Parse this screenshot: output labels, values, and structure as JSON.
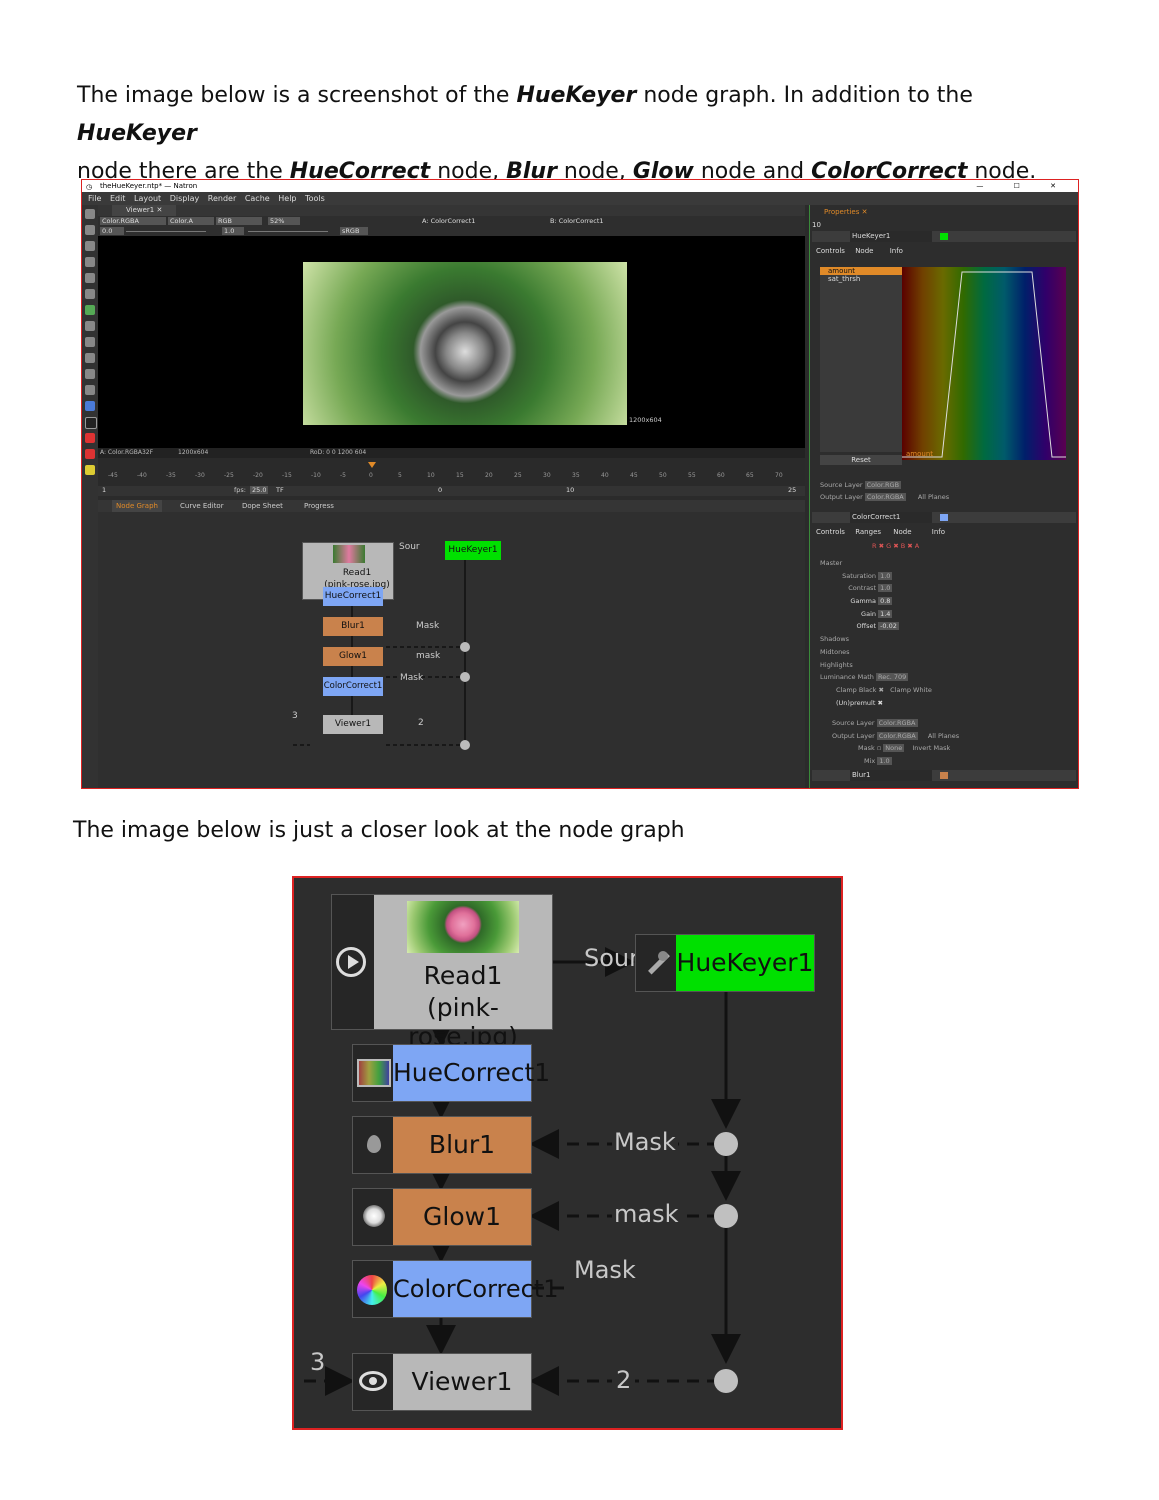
{
  "intro": {
    "line1_pre": "The image below is a screenshot of the ",
    "line1_b1": "HueKeyer",
    "line1_mid": " node graph. In addition to the ",
    "line1_b2": "HueKeyer",
    "line2_pre": "node there are the ",
    "line2_b1": "HueCorrect",
    "line2_s1": " node, ",
    "line2_b2": "Blur",
    "line2_s2": " node, ",
    "line2_b3": "Glow",
    "line2_s3": " node and ",
    "line2_b4": "ColorCorrect",
    "line2_s4": " node."
  },
  "screenshot": {
    "window_title": "theHueKeyer.ntp* — Natron",
    "window_controls": "—  ☐  ✕",
    "menu": [
      "File",
      "Edit",
      "Layout",
      "Display",
      "Render",
      "Cache",
      "Help",
      "Tools"
    ],
    "viewer_tab": "Viewer1  ✕",
    "layer": "Color.RGBA",
    "alpha": "Color.A",
    "channels": "RGB",
    "zoom": "52%",
    "exposure": "0.0",
    "gamma": "1.0",
    "colorspace": "sRGB",
    "input_a": "A: ColorCorrect1",
    "input_b": "B: ColorCorrect1",
    "image_size": "1200x604",
    "info_format": "A: Color.RGBA32F",
    "info_size": "1200x604",
    "info_rod": "RoD: 0 0 1200 604",
    "timeline_ticks": [
      "-45",
      "-40",
      "-35",
      "-30",
      "-25",
      "-20",
      "-15",
      "-10",
      "-5",
      "0",
      "5",
      "10",
      "15",
      "20",
      "25",
      "30",
      "35",
      "40",
      "45",
      "50",
      "55",
      "60",
      "65",
      "70"
    ],
    "frame_start": "1",
    "fps_label": "fps:",
    "fps": "25.0",
    "tf": "TF",
    "current_frame": "0",
    "increment": "10",
    "frame_end": "25",
    "panel_tabs": [
      "Node Graph",
      "Curve Editor",
      "Dope Sheet",
      "Progress"
    ],
    "mini_nodes": {
      "read": "Read1",
      "read_file": "(pink-rose.jpg)",
      "huekeyer": "HueKeyer1",
      "huecorrect": "HueCorrect1",
      "blur": "Blur1",
      "glow": "Glow1",
      "colorcorrect": "ColorCorrect1",
      "viewer": "Viewer1",
      "sour": "Sour",
      "mask1": "Mask",
      "mask2": "mask",
      "mask3": "Mask",
      "in3": "3",
      "in2": "2"
    },
    "properties_tab": "Properties  ✕",
    "props_count": "10",
    "hk_name": "HueKeyer1",
    "hk_subtabs": [
      "Controls",
      "Node",
      "Info"
    ],
    "hk_params": [
      "amount",
      "sat_thrsh"
    ],
    "reset": "Reset",
    "curve_label": "amount",
    "source_layer": "Source Layer",
    "source_layer_val": "Color.RGB",
    "output_layer": "Output Layer",
    "output_layer_val": "Color.RGBA",
    "all_planes": "All Planes",
    "cc_name": "ColorCorrect1",
    "cc_subtabs": [
      "Controls",
      "Ranges",
      "Node",
      "Info"
    ],
    "cc_rgba": "R ✖ G ✖ B ✖ A",
    "cc_master": "Master",
    "cc_params": [
      {
        "label": "Saturation",
        "value": "1.0"
      },
      {
        "label": "Contrast",
        "value": "1.0"
      },
      {
        "label": "Gamma",
        "value": "0.8"
      },
      {
        "label": "Gain",
        "value": "1.4"
      },
      {
        "label": "Offset",
        "value": "-0.02"
      }
    ],
    "cc_sections": [
      "Shadows",
      "Midtones",
      "Highlights"
    ],
    "lum_math": "Luminance Math",
    "lum_math_val": "Rec. 709",
    "clamp_black": "Clamp Black",
    "clamp_white": "Clamp White",
    "unpremult": "(Un)premult",
    "cc_source_layer_val": "Color.RGBA",
    "cc_output_layer_val": "Color.RGBA",
    "mask": "Mask",
    "mask_val": "None",
    "invert_mask": "Invert Mask",
    "mix": "Mix",
    "mix_val": "1.0",
    "blur_panel": "Blur1"
  },
  "middle_text": "The image below is just a closer look at the node graph",
  "graph": {
    "read_label": "Read1",
    "read_file": "(pink-rose.jpg)",
    "sour": "Sour",
    "huekeyer": "HueKeyer1",
    "huecorrect": "HueCorrect1",
    "blur": "Blur1",
    "glow": "Glow1",
    "colorcorrect": "ColorCorrect1",
    "viewer": "Viewer1",
    "mask_blur": "Mask",
    "mask_glow": "mask",
    "mask_cc": "Mask",
    "viewer_in3": "3",
    "viewer_in2": "2",
    "colors": {
      "huekeyer": "#00e000",
      "huecorrect": "#7ea6f4",
      "blur": "#c9824c",
      "glow": "#c9824c",
      "colorcorrect": "#7ea6f4",
      "read": "#b8b8b8",
      "viewer": "#b8b8b8"
    }
  }
}
